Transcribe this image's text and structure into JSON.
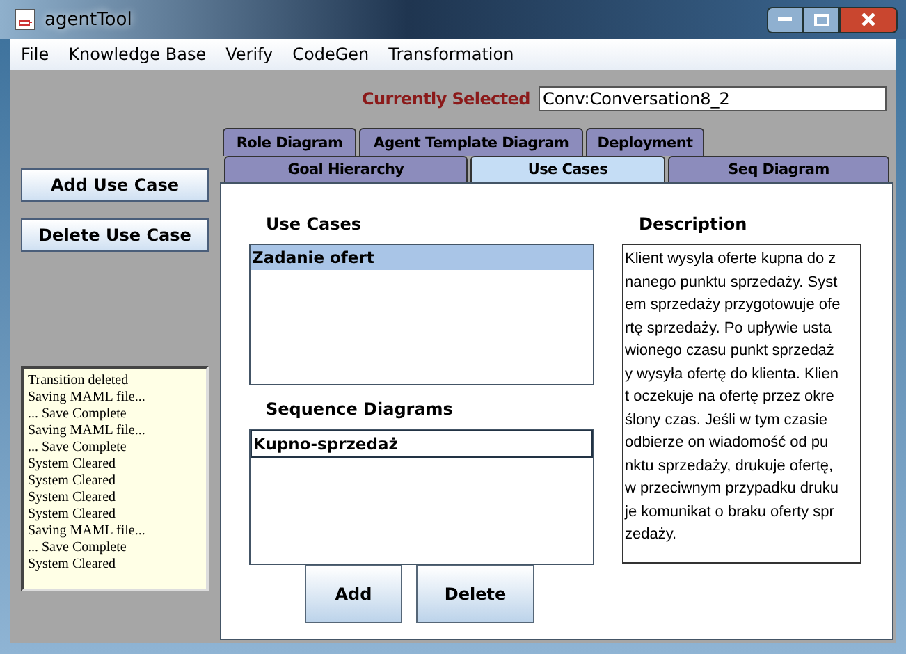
{
  "window": {
    "title": "agentTool"
  },
  "menu": [
    "File",
    "Knowledge Base",
    "Verify",
    "CodeGen",
    "Transformation"
  ],
  "currently_selected": {
    "label": "Currently Selected",
    "value": "Conv:Conversation8_2"
  },
  "side_buttons": [
    "Add Use Case",
    "Delete Use Case"
  ],
  "log": [
    "Transition deleted",
    "Saving MAML file...",
    "... Save Complete",
    "Saving MAML file...",
    "... Save Complete",
    "System Cleared",
    "System Cleared",
    "System Cleared",
    "System Cleared",
    "Saving MAML file...",
    "... Save Complete",
    "System Cleared"
  ],
  "tab_rows": [
    [
      {
        "label": "Role Diagram",
        "selected": false
      },
      {
        "label": "Agent Template Diagram",
        "selected": false
      },
      {
        "label": "Deployment",
        "selected": false
      }
    ],
    [
      {
        "label": "Goal Hierarchy",
        "selected": false
      },
      {
        "label": "Use Cases",
        "selected": true
      },
      {
        "label": "Seq Diagram",
        "selected": false
      }
    ]
  ],
  "use_cases": {
    "title": "Use Cases",
    "items": [
      {
        "label": "Zadanie ofert",
        "selected": true
      }
    ]
  },
  "sequence_diagrams": {
    "title": "Sequence Diagrams",
    "items": [
      {
        "label": "Kupno-sprzedaż",
        "selected": false
      }
    ]
  },
  "description": {
    "title": "Description",
    "lines": [
      "Klient wysyla oferte kupna do z",
      "nanego punktu sprzedaży. Syst",
      "em sprzedaży przygotowuje ofe",
      "rtę sprzedaży. Po upływie usta",
      "wionego czasu punkt sprzedaż",
      "y wysyła ofertę do klienta. Klien",
      "t oczekuje na ofertę przez okre",
      "ślony czas. Jeśli w tym czasie",
      "odbierze on wiadomość od pu",
      "nktu sprzedaży, drukuje ofertę,",
      "w przeciwnym przypadku druku",
      "je komunikat o braku oferty spr",
      "zedaży."
    ]
  },
  "buttons": [
    "Add",
    "Delete"
  ]
}
